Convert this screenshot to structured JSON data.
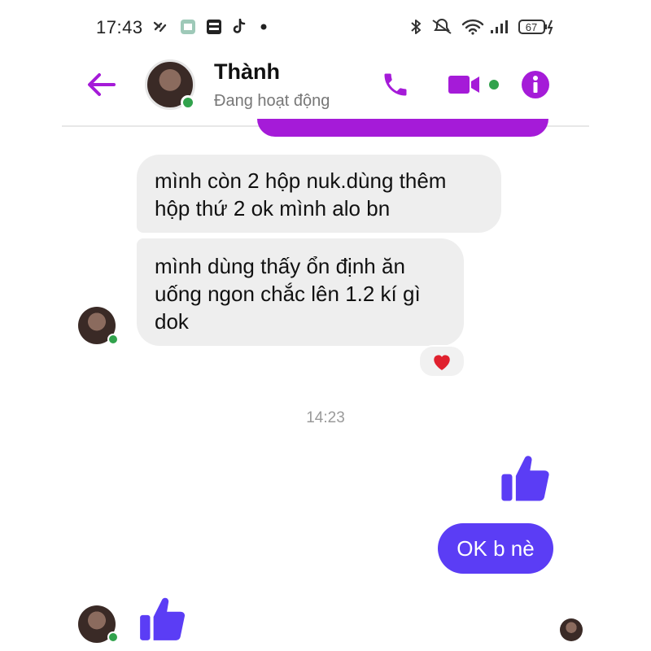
{
  "status_bar": {
    "time": "17:43",
    "battery": "67",
    "icons": [
      "notification-icon",
      "app-icon",
      "news-app-icon",
      "tiktok-icon",
      "dot-icon",
      "bluetooth-icon",
      "mute-icon",
      "wifi-icon",
      "signal-icon",
      "battery-icon"
    ]
  },
  "header": {
    "contact_name": "Thành",
    "contact_status": "Đang hoạt động",
    "online": true,
    "accent_color": "#a51bd8"
  },
  "messages": [
    {
      "direction": "incoming",
      "text_lines": [
        "mình còn 2 hộp nuk.dùng thêm",
        "hộp thứ 2 ok mình alo bn"
      ]
    },
    {
      "direction": "incoming",
      "text_lines": [
        "mình dùng thấy ổn định ăn",
        "uống ngon chắc lên 1.2 kí gì",
        "dok"
      ],
      "reaction": "heart"
    },
    {
      "type": "timestamp",
      "text": "14:23"
    },
    {
      "direction": "outgoing",
      "type": "like"
    },
    {
      "direction": "outgoing",
      "text_lines": [
        "OK b nè"
      ],
      "bubble_color": "#5b3df5"
    },
    {
      "direction": "incoming",
      "type": "like"
    }
  ]
}
